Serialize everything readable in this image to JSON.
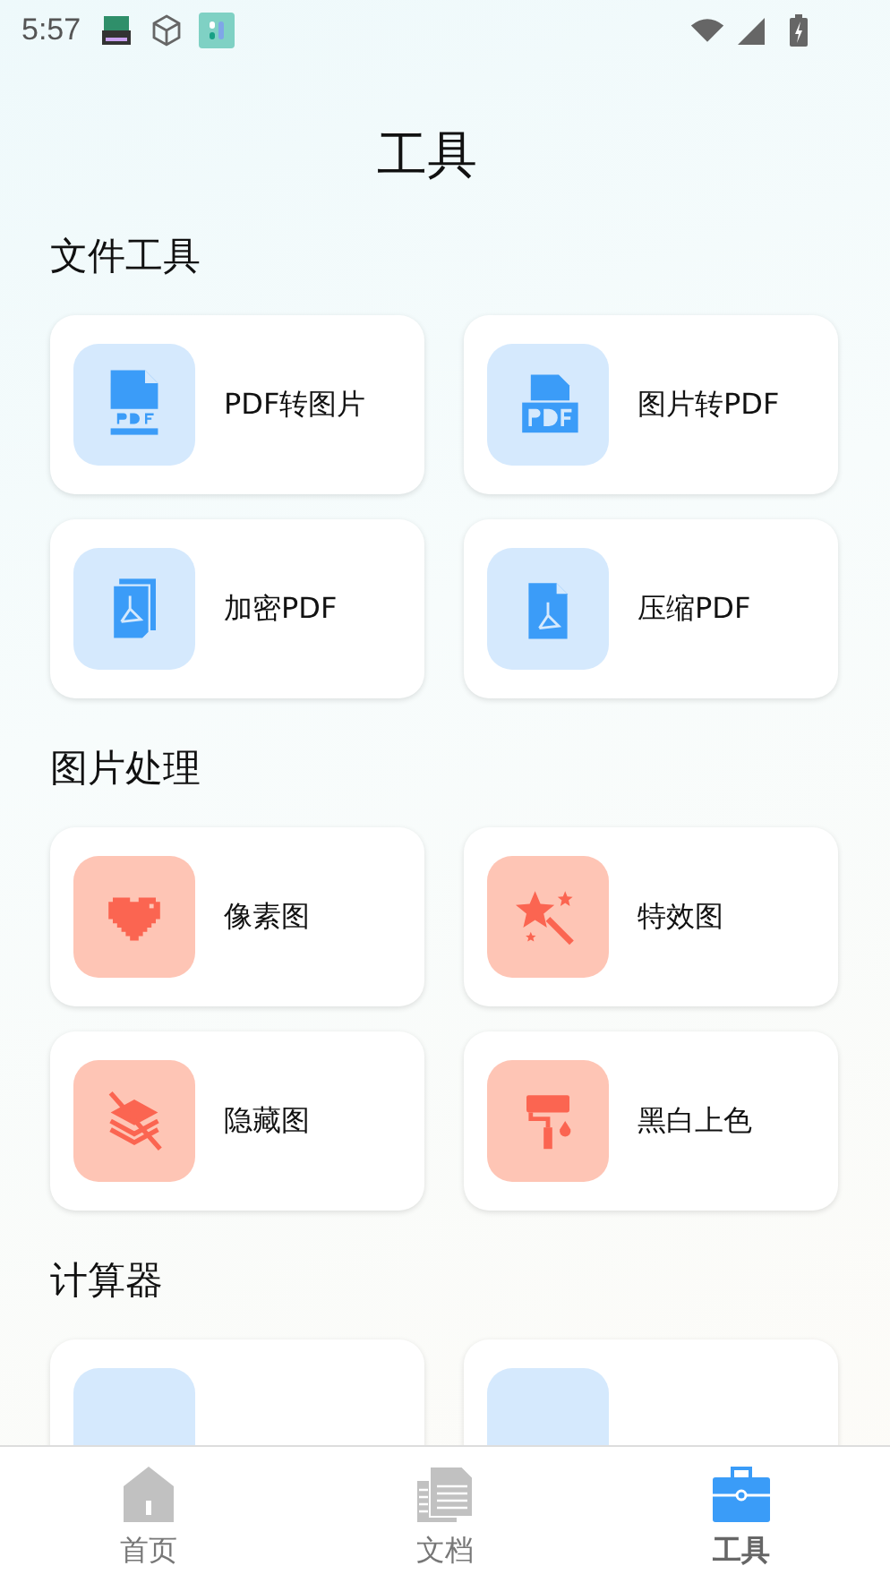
{
  "status_bar": {
    "time": "5:57"
  },
  "title": "工具",
  "sections": [
    {
      "heading": "文件工具",
      "kind": "file",
      "tools": [
        {
          "label": "PDF转图片",
          "kind": "pdfpage"
        },
        {
          "label": "图片转PDF",
          "kind": "pdfbadge"
        },
        {
          "label": "加密PDF",
          "kind": "pdfstack"
        },
        {
          "label": "压缩PDF",
          "kind": "pdffile"
        }
      ]
    },
    {
      "heading": "图片处理",
      "kind": "image",
      "tools": [
        {
          "label": "像素图",
          "kind": "pixel"
        },
        {
          "label": "特效图",
          "kind": "effect"
        },
        {
          "label": "隐藏图",
          "kind": "hide"
        },
        {
          "label": "黑白上色",
          "kind": "colorize"
        }
      ]
    },
    {
      "heading": "计算器",
      "kind": "calc",
      "tools": [
        {
          "kind": "partial"
        },
        {
          "kind": "partial"
        }
      ]
    }
  ],
  "tabs": [
    {
      "label": "首页",
      "kind": "home",
      "selected": false
    },
    {
      "label": "文档",
      "kind": "docs",
      "selected": false
    },
    {
      "label": "工具",
      "kind": "tools",
      "selected": true
    }
  ]
}
